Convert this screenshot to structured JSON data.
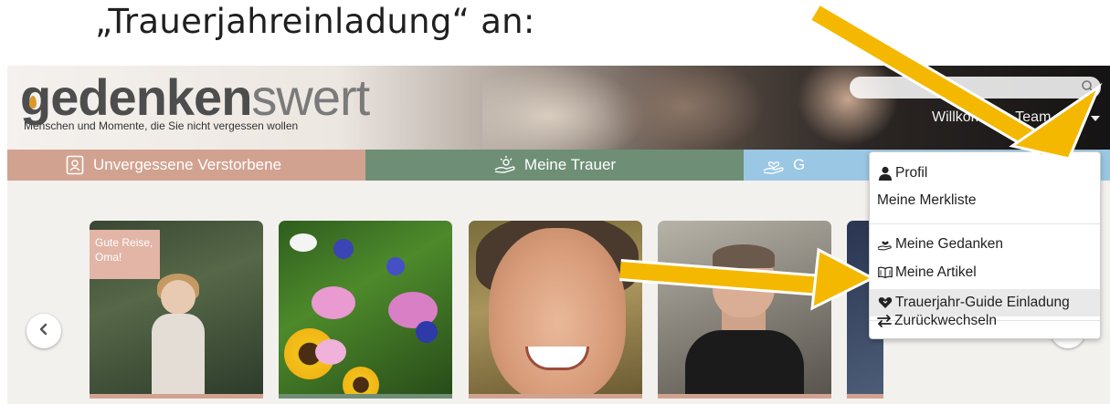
{
  "slide": {
    "heading": "„Trauerjahreinladung“ an:"
  },
  "header": {
    "logo_bold": "gedenken",
    "logo_light": "swert",
    "tagline": "Menschen und Momente, die Sie nicht vergessen wollen",
    "search": {
      "placeholder": "",
      "icon": "search-icon"
    },
    "welcome_text": "Willkommen Team gdw!"
  },
  "nav": {
    "tabs": [
      {
        "label": "Unvergessene Verstorbene",
        "icon": "portrait-frame-icon",
        "color": "#d2a290"
      },
      {
        "label": "Meine Trauer",
        "icon": "sunrise-hand-icon",
        "color": "#6e8f76"
      },
      {
        "label": "G",
        "icon": "heart-hand-icon",
        "color": "#9ac7e3"
      }
    ]
  },
  "carousel": {
    "cards": [
      {
        "caption": "Gute Reise, Oma!",
        "bar_color": "#d2a290"
      },
      {
        "caption": "",
        "bar_color": "#6e8f76"
      },
      {
        "caption": "",
        "bar_color": "#d2a290"
      },
      {
        "caption": "",
        "bar_color": "#d2a290"
      },
      {
        "caption": "",
        "bar_color": "#d2a290"
      }
    ],
    "prev_icon": "chevron-left-icon",
    "next_icon": "chevron-right-icon"
  },
  "dropdown": {
    "items": [
      {
        "label": "Profil",
        "icon": "user-icon"
      },
      {
        "label": "Meine Merkliste",
        "icon": ""
      },
      {
        "label": "Meine Gedanken",
        "icon": "heart-hand-icon"
      },
      {
        "label": "Meine Artikel",
        "icon": "book-icon"
      },
      {
        "label": "Trauerjahr-Guide Einladung",
        "icon": "heart-icon",
        "highlighted": true
      },
      {
        "label": "Zurückwechseln",
        "icon": "swap-arrows-icon"
      }
    ]
  },
  "annotations": {
    "arrow_color": "#f5b800",
    "arrow_outline": "#ffffff"
  }
}
